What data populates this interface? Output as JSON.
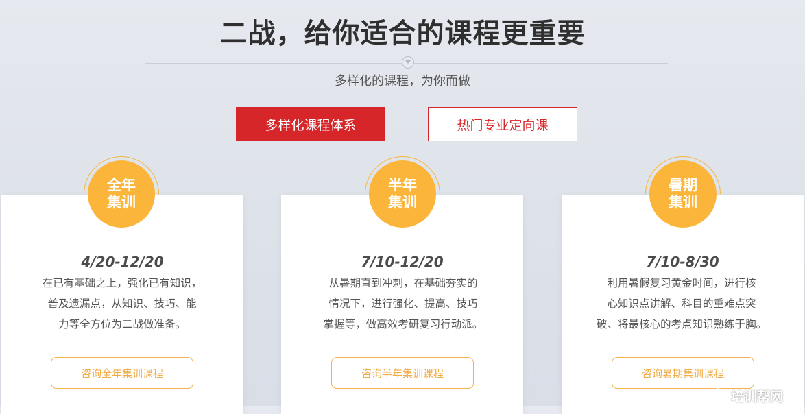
{
  "header": {
    "title": "二战，给你适合的课程更重要",
    "subtitle": "多样化的课程，为你而做"
  },
  "tabs": [
    {
      "label": "多样化课程体系",
      "active": true
    },
    {
      "label": "热门专业定向课",
      "active": false
    }
  ],
  "cards": [
    {
      "badge_line1": "全年",
      "badge_line2": "集训",
      "date": "4/20-12/20",
      "desc_lines": [
        "在已有基础之上，强化已有知识，",
        "普及遗漏点，从知识、技巧、能",
        "力等全方位为二战做准备。"
      ],
      "button": "咨询全年集训课程"
    },
    {
      "badge_line1": "半年",
      "badge_line2": "集训",
      "date": "7/10-12/20",
      "desc_lines": [
        "从暑期直到冲刺，在基础夯实的",
        "情况下，进行强化、提高、技巧",
        "掌握等，做高效考研复习行动派。"
      ],
      "button": "咨询半年集训课程"
    },
    {
      "badge_line1": "暑期",
      "badge_line2": "集训",
      "date": "7/10-8/30",
      "desc_lines": [
        "利用暑假复习黄金时间，进行核",
        "心知识点讲解、科目的重难点突",
        "破、将最核心的考点知识熟练于胸。"
      ],
      "button": "咨询暑期集训课程"
    }
  ],
  "watermark": {
    "text": "培训帮网",
    "icon": "sun-face-icon"
  },
  "colors": {
    "accent_red": "#d7262a",
    "badge_orange": "#fbb53a",
    "button_orange": "#f0ad48"
  }
}
